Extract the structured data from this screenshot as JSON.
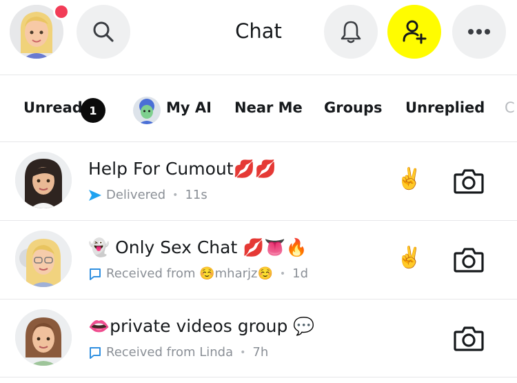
{
  "header": {
    "title": "Chat",
    "icons": [
      "avatar",
      "search-icon",
      "bell-icon",
      "add-friend-icon",
      "more-icon"
    ],
    "accent_yellow": "#fffc00",
    "notif_color": "#f23c57"
  },
  "tabs": [
    {
      "label": "Unread",
      "badge": "1"
    },
    {
      "label": "My AI"
    },
    {
      "label": "Near Me"
    },
    {
      "label": "Groups"
    },
    {
      "label": "Unreplied"
    },
    {
      "label": "C"
    }
  ],
  "chats": [
    {
      "name": "Help For Cumout💋💋",
      "status": "Delivered",
      "time": "11s",
      "status_icon": "delivered-arrow-icon",
      "friend_emoji": "✌️",
      "status_color": "#1fa2f0"
    },
    {
      "name": "👻 Only Sex Chat 💋👅🔥",
      "status": "Received from ☺️mharjz☺️",
      "time": "1d",
      "status_icon": "received-chat-icon",
      "friend_emoji": "✌️",
      "status_color": "#2f8fe0"
    },
    {
      "name": "👄private videos group 💬",
      "status": "Received from Linda",
      "time": "7h",
      "status_icon": "received-chat-icon",
      "friend_emoji": "",
      "status_color": "#2f8fe0"
    }
  ]
}
